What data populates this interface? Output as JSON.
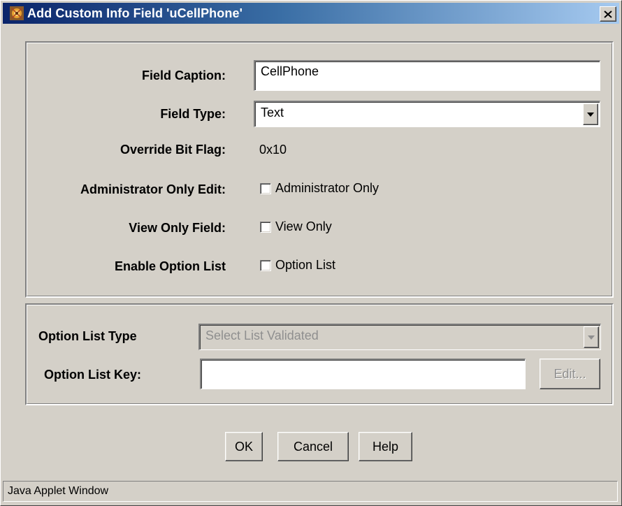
{
  "window": {
    "title": "Add Custom Info Field 'uCellPhone'",
    "close_glyph": "✕"
  },
  "fields": {
    "caption_label": "Field Caption:",
    "caption_value": "CellPhone",
    "type_label": "Field Type:",
    "type_value": "Text",
    "override_label": "Override Bit Flag:",
    "override_value": "0x10",
    "admin_label": "Administrator Only Edit:",
    "admin_checkbox": "Administrator Only",
    "view_label": "View Only Field:",
    "view_checkbox": "View Only",
    "option_label": "Enable Option List",
    "option_checkbox": "Option List"
  },
  "option_list": {
    "type_label": "Option List Type",
    "type_value": "Select List Validated",
    "key_label": "Option List Key:",
    "key_value": "",
    "edit_button": "Edit..."
  },
  "buttons": {
    "ok": "OK",
    "cancel": "Cancel",
    "help": "Help"
  },
  "status": {
    "text": "Java Applet Window"
  },
  "colors": {
    "titlebar_start": "#0a246a",
    "titlebar_end": "#a6caf0",
    "face": "#d4d0c8",
    "disabled_text": "#8f8f8f"
  },
  "icons": {
    "app": "java-coffee-icon",
    "close": "close-icon",
    "dropdown": "chevron-down-icon"
  }
}
